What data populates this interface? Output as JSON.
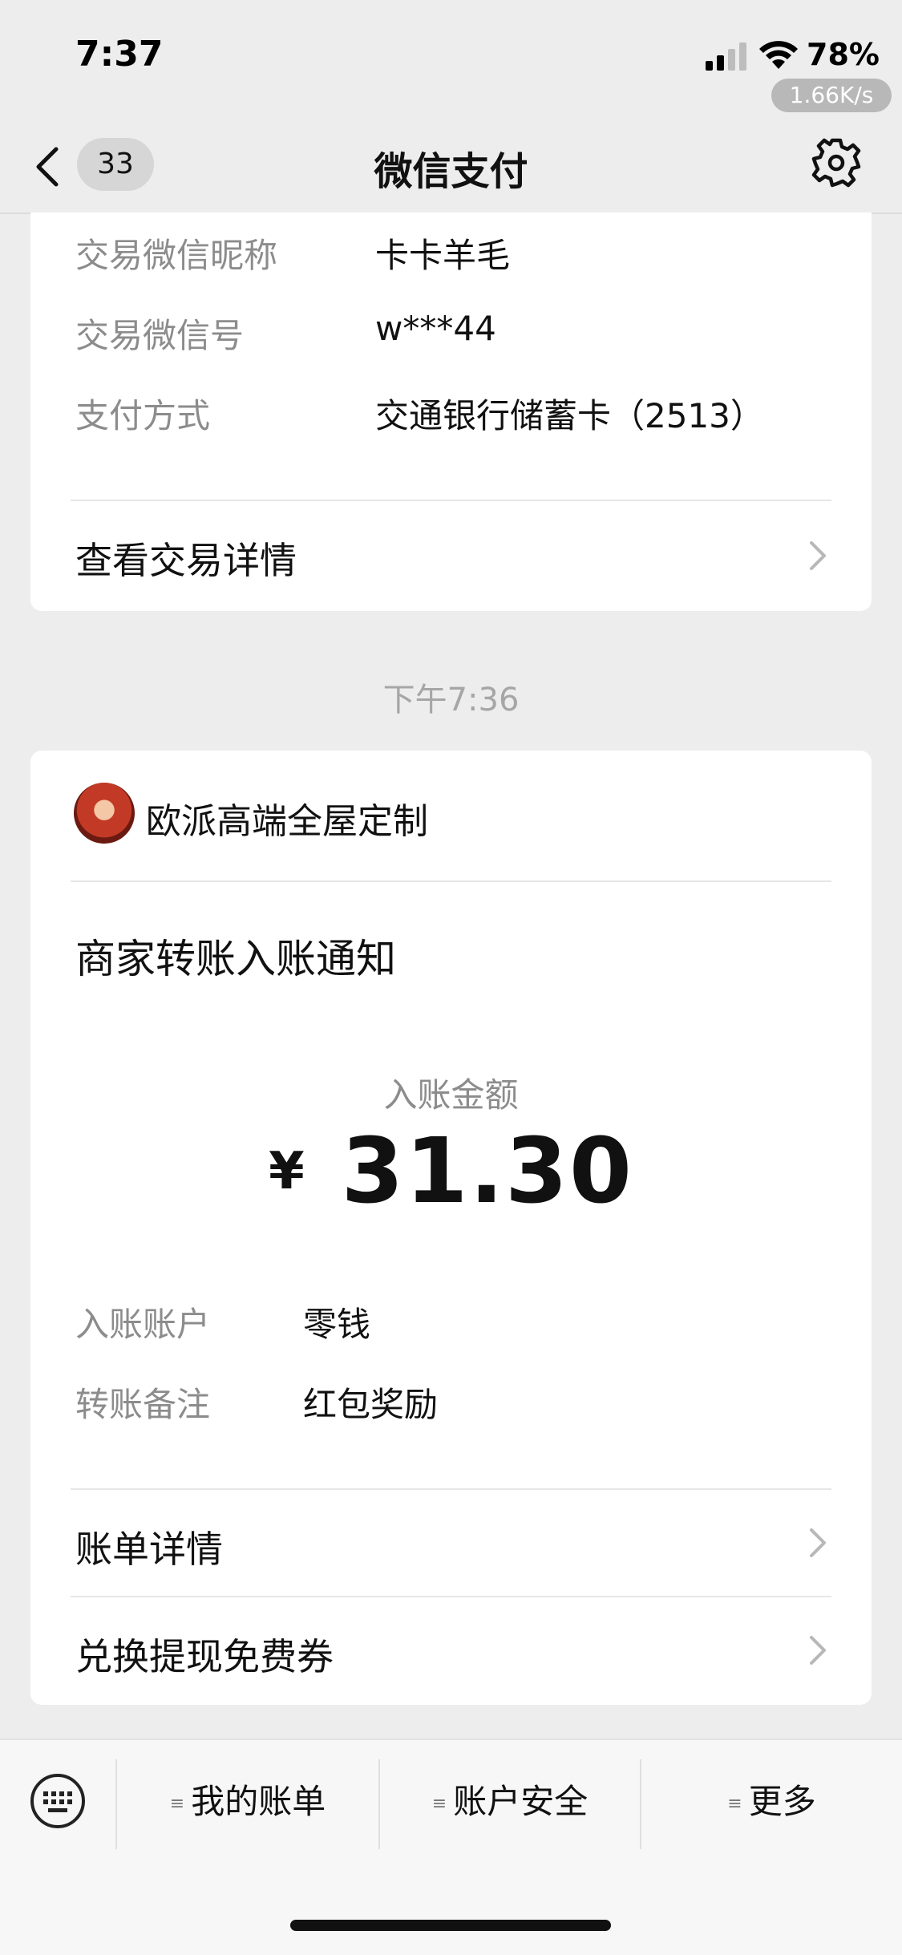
{
  "status_bar": {
    "time": "7:37",
    "battery": "78%",
    "net_speed": "1.66K/s"
  },
  "nav": {
    "badge": "33",
    "title": "微信支付"
  },
  "card1": {
    "rows": [
      {
        "label": "交易微信昵称",
        "value": "卡卡羊毛"
      },
      {
        "label": "交易微信号",
        "value": "w***44"
      },
      {
        "label": "支付方式",
        "value": "交通银行储蓄卡（2513）"
      }
    ],
    "link": "查看交易详情"
  },
  "timestamp": "下午7:36",
  "card2": {
    "merchant": "欧派高端全屋定制",
    "notice_title": "商家转账入账通知",
    "amount_label": "入账金额",
    "currency": "¥",
    "amount": "31.30",
    "rows": [
      {
        "label": "入账账户",
        "value": "零钱"
      },
      {
        "label": "转账备注",
        "value": "红包奖励"
      }
    ],
    "links": [
      "账单详情",
      "兑换提现免费券"
    ]
  },
  "bottom_menu": {
    "items": [
      "我的账单",
      "账户安全",
      "更多"
    ]
  },
  "colors": {
    "background": "#ededed",
    "card": "#ffffff",
    "label_gray": "#8c8c8c"
  }
}
